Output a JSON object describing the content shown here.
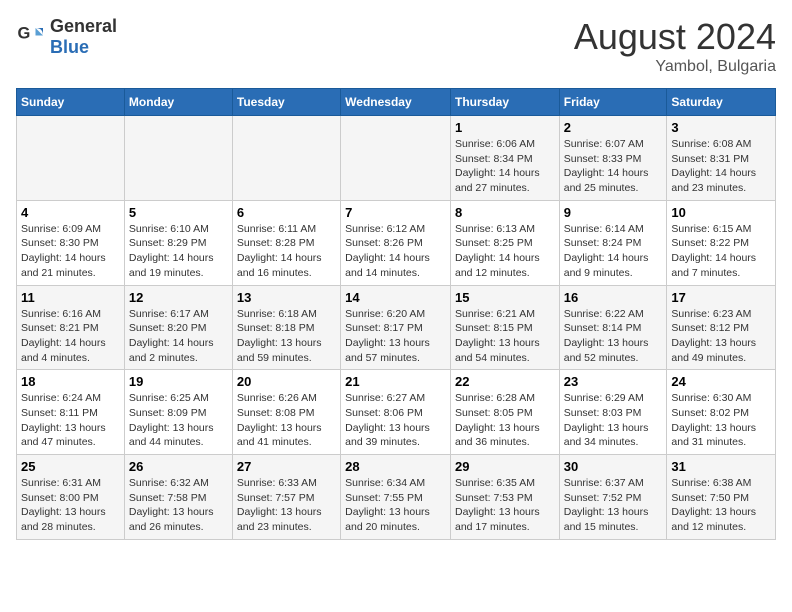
{
  "logo": {
    "text_general": "General",
    "text_blue": "Blue"
  },
  "title": "August 2024",
  "subtitle": "Yambol, Bulgaria",
  "days_of_week": [
    "Sunday",
    "Monday",
    "Tuesday",
    "Wednesday",
    "Thursday",
    "Friday",
    "Saturday"
  ],
  "weeks": [
    [
      {
        "day": "",
        "info": ""
      },
      {
        "day": "",
        "info": ""
      },
      {
        "day": "",
        "info": ""
      },
      {
        "day": "",
        "info": ""
      },
      {
        "day": "1",
        "info": "Sunrise: 6:06 AM\nSunset: 8:34 PM\nDaylight: 14 hours and 27 minutes."
      },
      {
        "day": "2",
        "info": "Sunrise: 6:07 AM\nSunset: 8:33 PM\nDaylight: 14 hours and 25 minutes."
      },
      {
        "day": "3",
        "info": "Sunrise: 6:08 AM\nSunset: 8:31 PM\nDaylight: 14 hours and 23 minutes."
      }
    ],
    [
      {
        "day": "4",
        "info": "Sunrise: 6:09 AM\nSunset: 8:30 PM\nDaylight: 14 hours and 21 minutes."
      },
      {
        "day": "5",
        "info": "Sunrise: 6:10 AM\nSunset: 8:29 PM\nDaylight: 14 hours and 19 minutes."
      },
      {
        "day": "6",
        "info": "Sunrise: 6:11 AM\nSunset: 8:28 PM\nDaylight: 14 hours and 16 minutes."
      },
      {
        "day": "7",
        "info": "Sunrise: 6:12 AM\nSunset: 8:26 PM\nDaylight: 14 hours and 14 minutes."
      },
      {
        "day": "8",
        "info": "Sunrise: 6:13 AM\nSunset: 8:25 PM\nDaylight: 14 hours and 12 minutes."
      },
      {
        "day": "9",
        "info": "Sunrise: 6:14 AM\nSunset: 8:24 PM\nDaylight: 14 hours and 9 minutes."
      },
      {
        "day": "10",
        "info": "Sunrise: 6:15 AM\nSunset: 8:22 PM\nDaylight: 14 hours and 7 minutes."
      }
    ],
    [
      {
        "day": "11",
        "info": "Sunrise: 6:16 AM\nSunset: 8:21 PM\nDaylight: 14 hours and 4 minutes."
      },
      {
        "day": "12",
        "info": "Sunrise: 6:17 AM\nSunset: 8:20 PM\nDaylight: 14 hours and 2 minutes."
      },
      {
        "day": "13",
        "info": "Sunrise: 6:18 AM\nSunset: 8:18 PM\nDaylight: 13 hours and 59 minutes."
      },
      {
        "day": "14",
        "info": "Sunrise: 6:20 AM\nSunset: 8:17 PM\nDaylight: 13 hours and 57 minutes."
      },
      {
        "day": "15",
        "info": "Sunrise: 6:21 AM\nSunset: 8:15 PM\nDaylight: 13 hours and 54 minutes."
      },
      {
        "day": "16",
        "info": "Sunrise: 6:22 AM\nSunset: 8:14 PM\nDaylight: 13 hours and 52 minutes."
      },
      {
        "day": "17",
        "info": "Sunrise: 6:23 AM\nSunset: 8:12 PM\nDaylight: 13 hours and 49 minutes."
      }
    ],
    [
      {
        "day": "18",
        "info": "Sunrise: 6:24 AM\nSunset: 8:11 PM\nDaylight: 13 hours and 47 minutes."
      },
      {
        "day": "19",
        "info": "Sunrise: 6:25 AM\nSunset: 8:09 PM\nDaylight: 13 hours and 44 minutes."
      },
      {
        "day": "20",
        "info": "Sunrise: 6:26 AM\nSunset: 8:08 PM\nDaylight: 13 hours and 41 minutes."
      },
      {
        "day": "21",
        "info": "Sunrise: 6:27 AM\nSunset: 8:06 PM\nDaylight: 13 hours and 39 minutes."
      },
      {
        "day": "22",
        "info": "Sunrise: 6:28 AM\nSunset: 8:05 PM\nDaylight: 13 hours and 36 minutes."
      },
      {
        "day": "23",
        "info": "Sunrise: 6:29 AM\nSunset: 8:03 PM\nDaylight: 13 hours and 34 minutes."
      },
      {
        "day": "24",
        "info": "Sunrise: 6:30 AM\nSunset: 8:02 PM\nDaylight: 13 hours and 31 minutes."
      }
    ],
    [
      {
        "day": "25",
        "info": "Sunrise: 6:31 AM\nSunset: 8:00 PM\nDaylight: 13 hours and 28 minutes."
      },
      {
        "day": "26",
        "info": "Sunrise: 6:32 AM\nSunset: 7:58 PM\nDaylight: 13 hours and 26 minutes."
      },
      {
        "day": "27",
        "info": "Sunrise: 6:33 AM\nSunset: 7:57 PM\nDaylight: 13 hours and 23 minutes."
      },
      {
        "day": "28",
        "info": "Sunrise: 6:34 AM\nSunset: 7:55 PM\nDaylight: 13 hours and 20 minutes."
      },
      {
        "day": "29",
        "info": "Sunrise: 6:35 AM\nSunset: 7:53 PM\nDaylight: 13 hours and 17 minutes."
      },
      {
        "day": "30",
        "info": "Sunrise: 6:37 AM\nSunset: 7:52 PM\nDaylight: 13 hours and 15 minutes."
      },
      {
        "day": "31",
        "info": "Sunrise: 6:38 AM\nSunset: 7:50 PM\nDaylight: 13 hours and 12 minutes."
      }
    ]
  ]
}
